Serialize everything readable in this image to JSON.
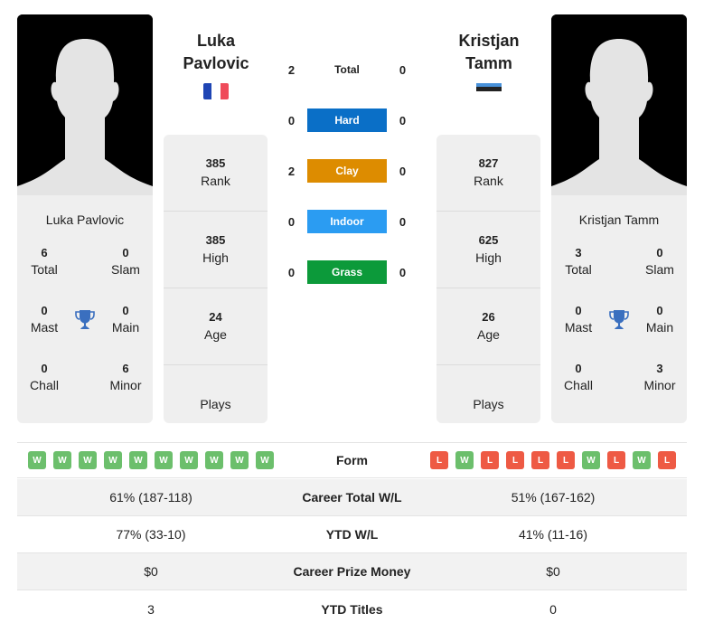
{
  "player1": {
    "name_line1": "Luka",
    "name_line2": "Pavlovic",
    "full_name": "Luka Pavlovic",
    "flag": "france",
    "flag_colors": [
      "#1f45b4",
      "#ffffff",
      "#ef4b5a"
    ],
    "titles": {
      "total": {
        "value": "6",
        "label": "Total"
      },
      "slam": {
        "value": "0",
        "label": "Slam"
      },
      "mast": {
        "value": "0",
        "label": "Mast"
      },
      "main": {
        "value": "0",
        "label": "Main"
      },
      "chall": {
        "value": "0",
        "label": "Chall"
      },
      "minor": {
        "value": "6",
        "label": "Minor"
      }
    },
    "stats": {
      "rank": {
        "value": "385",
        "label": "Rank"
      },
      "high": {
        "value": "385",
        "label": "High"
      },
      "age": {
        "value": "24",
        "label": "Age"
      },
      "plays": {
        "value": "",
        "label": "Plays"
      }
    },
    "form": [
      "W",
      "W",
      "W",
      "W",
      "W",
      "W",
      "W",
      "W",
      "W",
      "W"
    ]
  },
  "player2": {
    "name_line1": "Kristjan",
    "name_line2": "Tamm",
    "full_name": "Kristjan Tamm",
    "flag": "estonia",
    "flag_colors": [
      "#4891d9",
      "#222222",
      "#ffffff"
    ],
    "titles": {
      "total": {
        "value": "3",
        "label": "Total"
      },
      "slam": {
        "value": "0",
        "label": "Slam"
      },
      "mast": {
        "value": "0",
        "label": "Mast"
      },
      "main": {
        "value": "0",
        "label": "Main"
      },
      "chall": {
        "value": "0",
        "label": "Chall"
      },
      "minor": {
        "value": "3",
        "label": "Minor"
      }
    },
    "stats": {
      "rank": {
        "value": "827",
        "label": "Rank"
      },
      "high": {
        "value": "625",
        "label": "High"
      },
      "age": {
        "value": "26",
        "label": "Age"
      },
      "plays": {
        "value": "",
        "label": "Plays"
      }
    },
    "form": [
      "L",
      "W",
      "L",
      "L",
      "L",
      "L",
      "W",
      "L",
      "W",
      "L"
    ]
  },
  "h2h": [
    {
      "label": "Total",
      "p1": "2",
      "p2": "0",
      "color": ""
    },
    {
      "label": "Hard",
      "p1": "0",
      "p2": "0",
      "color": "#0a6fc7"
    },
    {
      "label": "Clay",
      "p1": "2",
      "p2": "0",
      "color": "#dd8c00"
    },
    {
      "label": "Indoor",
      "p1": "0",
      "p2": "0",
      "color": "#2b9cf2"
    },
    {
      "label": "Grass",
      "p1": "0",
      "p2": "0",
      "color": "#0c9a3a"
    }
  ],
  "form_label": "Form",
  "comparison": [
    {
      "label": "Career Total W/L",
      "p1": "61% (187-118)",
      "p2": "51% (167-162)"
    },
    {
      "label": "YTD W/L",
      "p1": "77% (33-10)",
      "p2": "41% (11-16)"
    },
    {
      "label": "Career Prize Money",
      "p1": "$0",
      "p2": "$0"
    },
    {
      "label": "YTD Titles",
      "p1": "3",
      "p2": "0"
    }
  ]
}
